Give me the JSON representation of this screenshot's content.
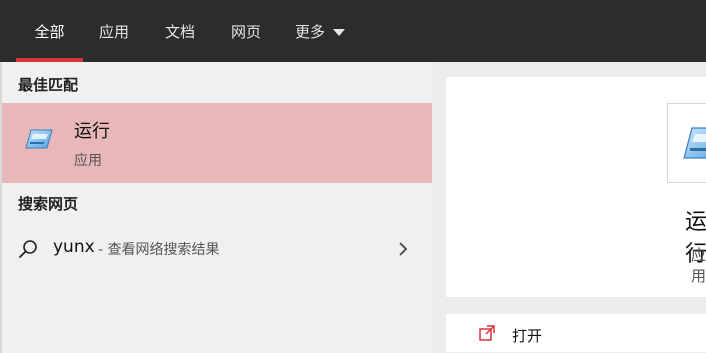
{
  "tabs": [
    {
      "label": "全部"
    },
    {
      "label": "应用"
    },
    {
      "label": "文档"
    },
    {
      "label": "网页"
    },
    {
      "label": "更多"
    }
  ],
  "accent_color": "#d9333a",
  "sections": {
    "best_match": "最佳匹配",
    "web_search": "搜索网页"
  },
  "best_match": {
    "title": "运行",
    "subtitle": "应用",
    "icon": "run-icon"
  },
  "web_result": {
    "query": "yunx",
    "hint": "- 查看网络搜索结果",
    "icon": "search-icon"
  },
  "detail": {
    "title": "运行",
    "subtitle": "应用",
    "open_label": "打开",
    "open_icon": "open-icon"
  }
}
